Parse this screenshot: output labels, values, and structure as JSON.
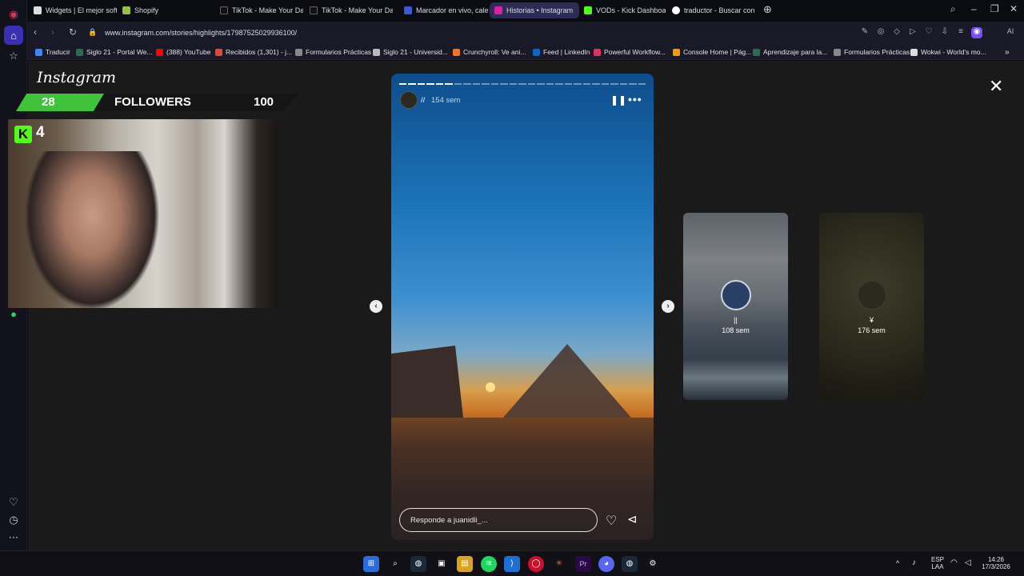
{
  "browser": {
    "tabs": [
      {
        "label": "Widgets | El mejor softwa",
        "active": false
      },
      {
        "label": "Shopify",
        "active": false
      },
      {
        "label": "TikTok - Make Your Day",
        "active": false
      },
      {
        "label": "TikTok - Make Your Day",
        "active": false
      },
      {
        "label": "Marcador en vivo, calenda",
        "active": false
      },
      {
        "label": "Historias • Instagram",
        "active": true
      },
      {
        "label": "VODs - Kick Dashboard",
        "active": false
      },
      {
        "label": "traductor - Buscar con Go",
        "active": false
      }
    ],
    "url": "www.instagram.com/stories/highlights/17987525029936100/",
    "ai_label": "AI",
    "bookmarks": [
      "Traducir",
      "Siglo 21 - Portal We...",
      "(388) YouTube",
      "Recibidos (1,301) - j...",
      "Formularios Prácticas",
      "Siglo 21 - Universid...",
      "Crunchyroll: Ve ani...",
      "Feed | LinkedIn",
      "Powerful Workflow...",
      "Console Home | Pág...",
      "Aprendizaje para la...",
      "Formularios Prácticas",
      "Wokwi - World's mo..."
    ]
  },
  "overlay": {
    "logo_text": "Instagram",
    "followers_current": "28",
    "followers_label": "FOLLOWERS",
    "followers_goal": "100",
    "kick_icon": "K",
    "viewer_count": "4"
  },
  "story": {
    "user": "//",
    "time": "154 sem",
    "reply_placeholder": "Responde a juanidli_...",
    "progress_segments_done": 6,
    "progress_segments_total": 27
  },
  "previews": [
    {
      "user": "||",
      "time": "108 sem"
    },
    {
      "user": "¥",
      "time": "176 sem"
    }
  ],
  "taskbar": {
    "language": "ESP",
    "layout": "LAA",
    "time": "14:26",
    "date": "17/3/2026"
  },
  "colors": {
    "accent": "#3a2fb0",
    "followers_green": "#3fc33a",
    "kick_green": "#53fc18"
  }
}
